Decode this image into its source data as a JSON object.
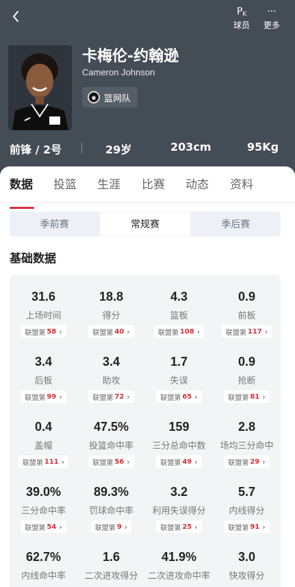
{
  "header": {
    "actions": [
      {
        "icon": "pk-icon",
        "glyph_main": "P",
        "glyph_sub": "K",
        "label": "球员"
      },
      {
        "icon": "more-dots-icon",
        "glyph": "···",
        "label": "更多"
      }
    ],
    "player_name": "卡梅伦-约翰逊",
    "player_name_en": "Cameron Johnson",
    "team": "篮网队",
    "info": {
      "position": "前锋 / 2号",
      "age": "29岁",
      "height": "203cm",
      "weight": "95Kg"
    }
  },
  "tabs": [
    "数据",
    "投篮",
    "生涯",
    "比赛",
    "动态",
    "资料"
  ],
  "active_tab": "数据",
  "season_types": [
    "季前赛",
    "常规赛",
    "季后赛"
  ],
  "active_season_type": "常规赛",
  "section_title": "基础数据",
  "rank_prefix": "联盟第",
  "stats": [
    {
      "value": "31.6",
      "label": "上场时间",
      "rank": "58"
    },
    {
      "value": "18.8",
      "label": "得分",
      "rank": "40"
    },
    {
      "value": "4.3",
      "label": "篮板",
      "rank": "108"
    },
    {
      "value": "0.9",
      "label": "前板",
      "rank": "117"
    },
    {
      "value": "3.4",
      "label": "后板",
      "rank": "99"
    },
    {
      "value": "3.4",
      "label": "助攻",
      "rank": "72"
    },
    {
      "value": "1.7",
      "label": "失误",
      "rank": "65"
    },
    {
      "value": "0.9",
      "label": "抢断",
      "rank": "81"
    },
    {
      "value": "0.4",
      "label": "盖帽",
      "rank": "111"
    },
    {
      "value": "47.5%",
      "label": "投篮命中率",
      "rank": "56"
    },
    {
      "value": "159",
      "label": "三分总命中数",
      "rank": "49"
    },
    {
      "value": "2.8",
      "label": "场均三分命中",
      "rank": "29"
    },
    {
      "value": "39.0%",
      "label": "三分命中率",
      "rank": "54"
    },
    {
      "value": "89.3%",
      "label": "罚球命中率",
      "rank": "9"
    },
    {
      "value": "3.2",
      "label": "利用失误得分",
      "rank": "25"
    },
    {
      "value": "5.7",
      "label": "内线得分",
      "rank": "91"
    },
    {
      "value": "62.7%",
      "label": "内线命中率",
      "rank": ""
    },
    {
      "value": "1.6",
      "label": "二次进攻得分",
      "rank": ""
    },
    {
      "value": "41.9%",
      "label": "二次进攻命中率",
      "rank": ""
    },
    {
      "value": "3.0",
      "label": "快攻得分",
      "rank": ""
    }
  ],
  "colors": {
    "header_bg": "#444c56",
    "accent_red": "#d3303a",
    "card_bg": "#f3f4f6"
  }
}
